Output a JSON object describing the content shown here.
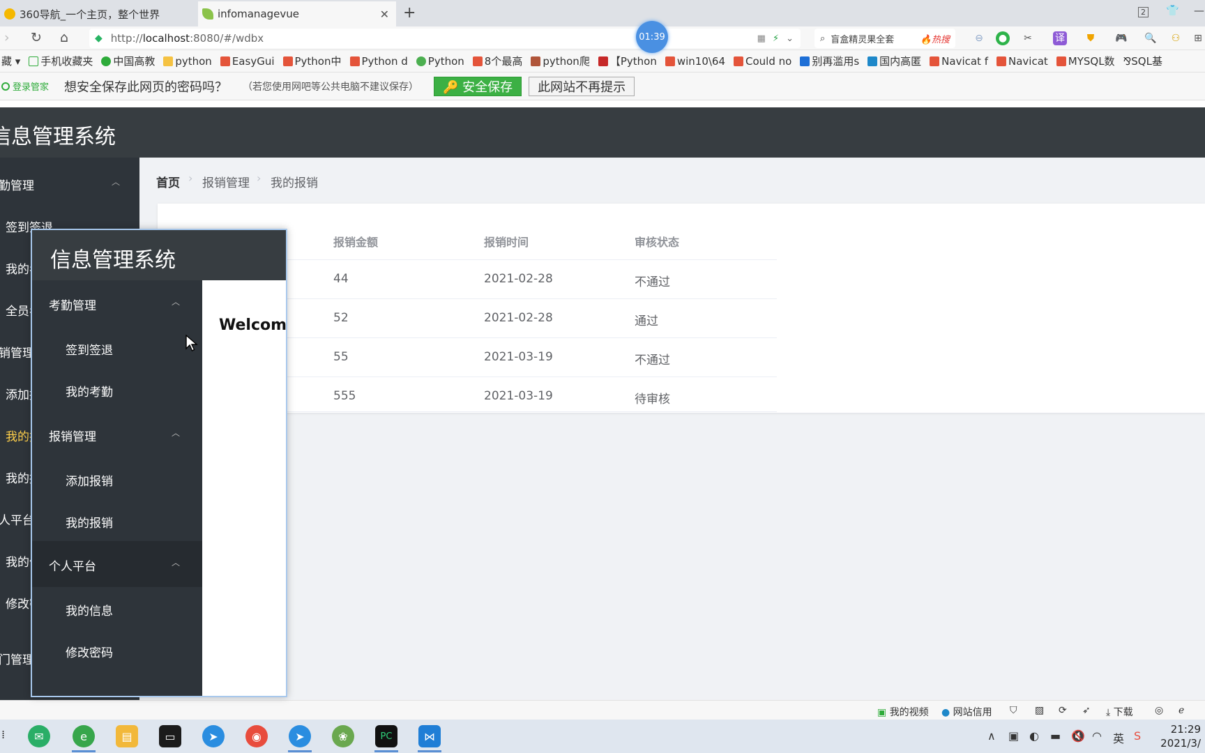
{
  "browser": {
    "tabs": [
      {
        "title": "360导航_一个主页，整个世界",
        "active": false
      },
      {
        "title": "infomanagevue",
        "active": true
      }
    ],
    "window_badge": "2",
    "url_prefix": "http://",
    "url_host": "localhost",
    "url_rest": ":8080/#/wdbx",
    "timer": "01:39",
    "search_text": "盲盒精灵果全套",
    "search_hot": "🔥热搜",
    "bookmarks": [
      "手机收藏夹",
      "中国高教",
      "python",
      "EasyGui",
      "Python中",
      "Python d",
      "Python",
      "8个最高",
      "python爬",
      "【Python",
      "win10\\64",
      "Could no",
      "别再滥用s",
      "国内高匿",
      "Navicat f",
      "Navicat",
      "MYSQL数",
      "SQL基"
    ]
  },
  "password_bar": {
    "brand": "登录管家",
    "question": "想安全保存此网页的密码吗？",
    "note": "（若您使用网吧等公共电脑不建议保存）",
    "save_label": "🔑 安全保存",
    "dismiss_label": "此网站不再提示"
  },
  "app": {
    "title": "信息管理系统",
    "bg_sidebar": [
      "勤管理",
      "签到签退",
      "我的考",
      "全员考",
      "销管理",
      "添加报",
      "我的报",
      "我的报",
      "人平台",
      "我的信",
      "修改密",
      "门管理"
    ],
    "breadcrumb": [
      "首页",
      "报销管理",
      "我的报销"
    ],
    "table": {
      "headers": [
        "报销金额",
        "报销时间",
        "审核状态"
      ],
      "rows": [
        [
          "44",
          "2021-02-28",
          "不通过"
        ],
        [
          "52",
          "2021-02-28",
          "通过"
        ],
        [
          "55",
          "2021-03-19",
          "不通过"
        ],
        [
          "555",
          "2021-03-19",
          "待审核"
        ]
      ]
    }
  },
  "overlay": {
    "title": "信息管理系统",
    "welcome": "Welcome",
    "groups": [
      {
        "label": "考勤管理",
        "items": [
          "签到签退",
          "我的考勤"
        ]
      },
      {
        "label": "报销管理",
        "items": [
          "添加报销",
          "我的报销"
        ]
      },
      {
        "label": "个人平台",
        "items": [
          "我的信息",
          "修改密码"
        ]
      }
    ]
  },
  "statusbar": {
    "items": [
      "我的视频",
      "网站信用",
      "下载"
    ]
  },
  "taskbar": {
    "time": "21:29",
    "date": "2021/3/",
    "ime": "英"
  },
  "colors": {
    "header_bg": "#373d41",
    "sidebar_bg": "#2e343a",
    "active_menu": "#ffd04b",
    "save_green": "#3cb044"
  }
}
